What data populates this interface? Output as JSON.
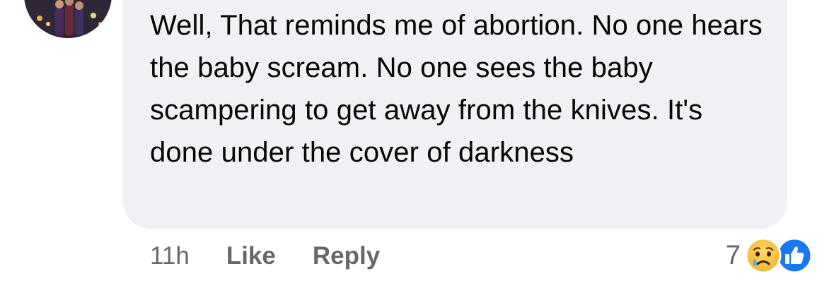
{
  "comment": {
    "text": "Well, That reminds me of abortion. No one hears the baby scream. No one sees the baby scampering to get away from the knives. It's done under the cover of darkness",
    "timestamp": "11h",
    "like_label": "Like",
    "reply_label": "Reply",
    "reaction_count": "7",
    "reaction_icons": [
      "sad-icon",
      "like-icon"
    ]
  },
  "colors": {
    "bubble_background": "#f0f1f5",
    "text": "#050505",
    "secondary_text": "#65676b",
    "like_blue": "#1877f2",
    "sad_yellow": "#f7c744"
  }
}
